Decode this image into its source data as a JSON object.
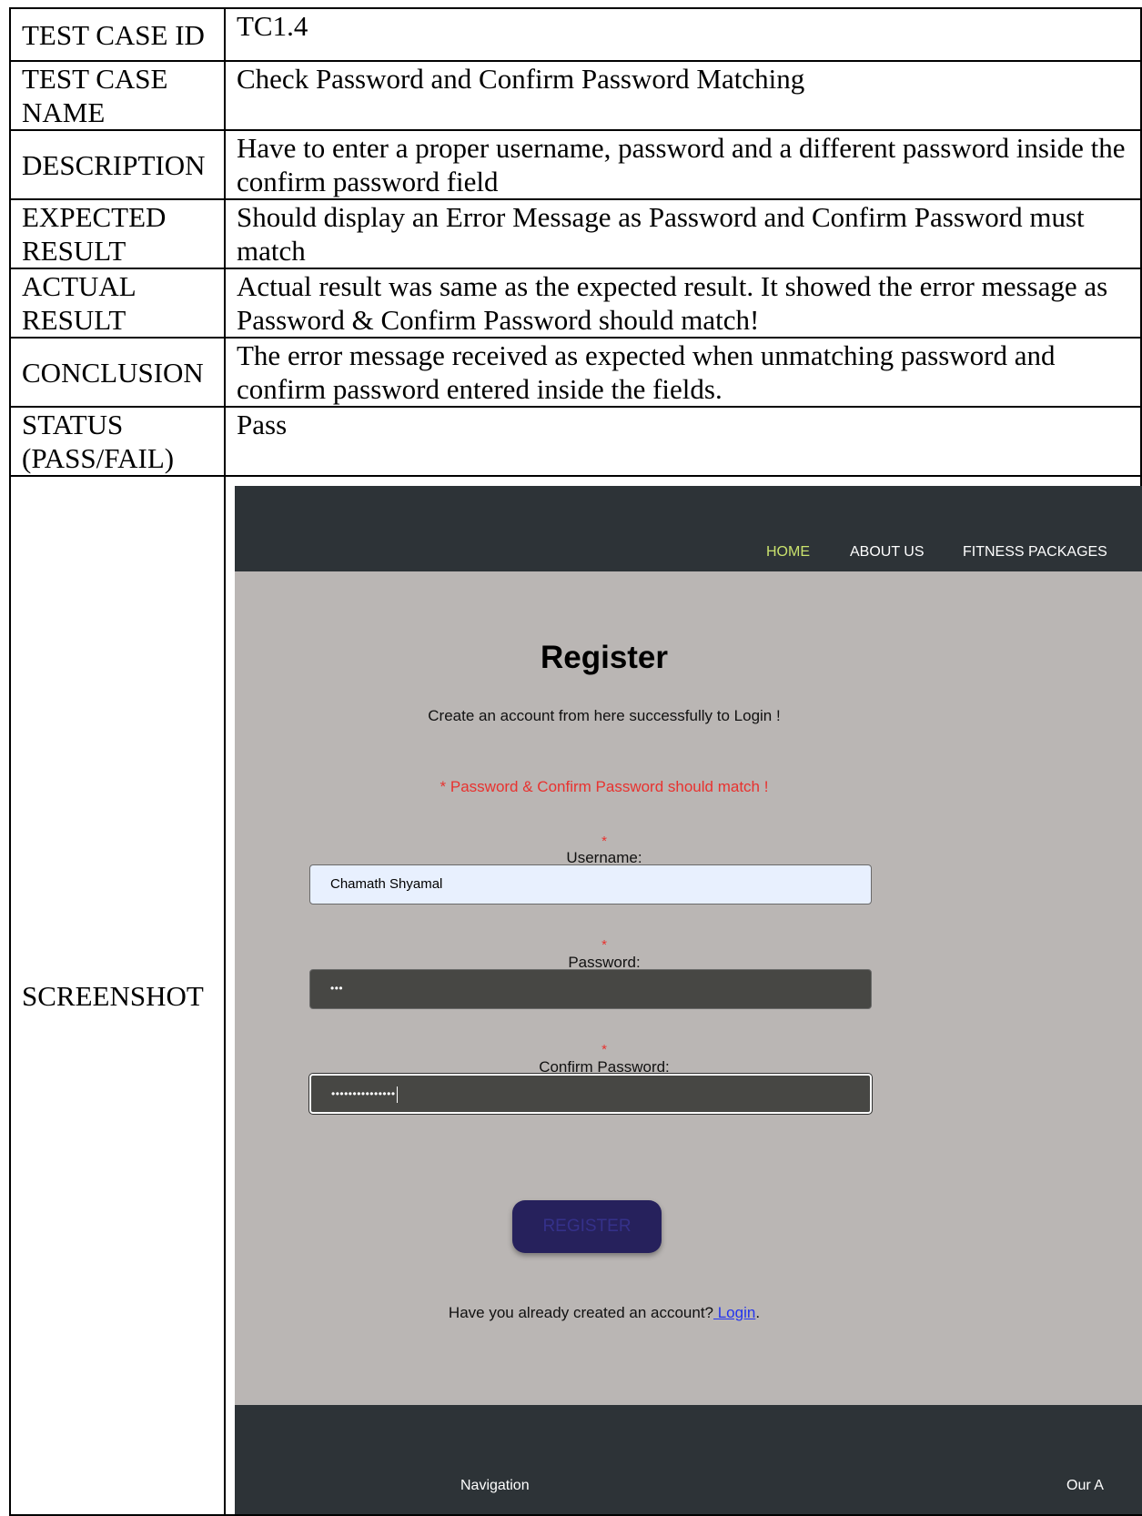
{
  "rows": [
    {
      "label": "TEST CASE ID",
      "value": "TC1.4"
    },
    {
      "label": "TEST CASE NAME",
      "value": "Check Password and Confirm Password Matching"
    },
    {
      "label": "DESCRIPTION",
      "value": "Have to enter a proper username, password and a different password inside the confirm password field"
    },
    {
      "label": "EXPECTED RESULT",
      "value": "Should display an Error Message as Password and Confirm Password must match"
    },
    {
      "label": "ACTUAL RESULT",
      "value": "Actual result was same as the expected result. It showed the error message as Password & Confirm Password should match!"
    },
    {
      "label": "CONCLUSION",
      "value": "The error message received as expected when unmatching password and confirm password entered inside the fields."
    },
    {
      "label": "STATUS (PASS/FAIL)",
      "value": "Pass"
    },
    {
      "label": "SCREENSHOT"
    }
  ],
  "screenshot": {
    "nav": {
      "home": "HOME",
      "about": "ABOUT US",
      "packages": "FITNESS PACKAGES",
      "active_color": "#c9e26d",
      "bar_color": "#2d3337"
    },
    "form": {
      "title": "Register",
      "subtitle": "Create an account from here successfully to Login !",
      "error": "* Password & Confirm Password should match !",
      "required_mark": "*",
      "username_label": "Username:",
      "username_value": "Chamath Shyamal",
      "password_label": "Password:",
      "password_value": "•••",
      "confirm_label": "Confirm Password:",
      "confirm_value": "•••••••••••••••",
      "register_button": "REGISTER",
      "login_prompt": "Have you already created an account?",
      "login_link": " Login",
      "login_suffix": ".",
      "error_color": "#e8322f",
      "page_bg": "#bab6b4",
      "button_color": "#26215c"
    },
    "footer": {
      "navigation": "Navigation",
      "our": "Our A"
    }
  }
}
